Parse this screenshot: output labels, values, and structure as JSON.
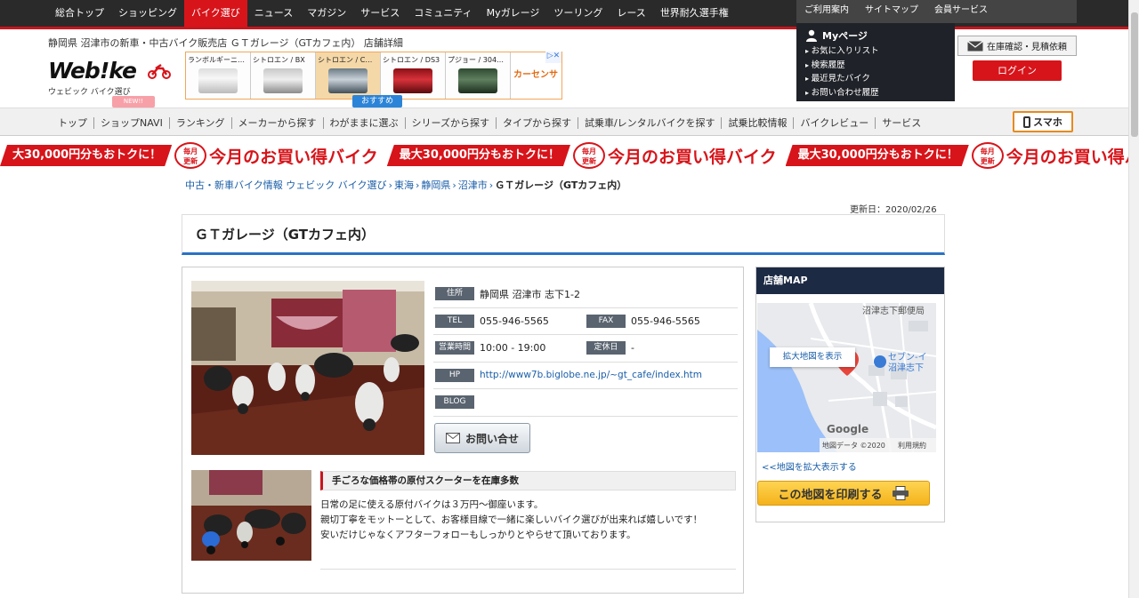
{
  "topnav": {
    "items": [
      "総合トップ",
      "ショッピング",
      "バイク選び",
      "ニュース",
      "マガジン",
      "サービス",
      "コミュニティ",
      "Myガレージ",
      "ツーリング",
      "レース",
      "世界耐久選手権"
    ],
    "active_index": 2,
    "sub_items": [
      "ご利用案内",
      "サイトマップ",
      "会員サービス"
    ]
  },
  "header": {
    "breadcrumb_title": "静岡県 沼津市の新車・中古バイク販売店 ＧＴガレージ（GTカフェ内） 店舗詳細",
    "logo_text": "Web!ke",
    "logo_tagline": "ウェビック バイク選び",
    "new_badge": "NEW!!",
    "recommend_label": "おすすめ",
    "ad_badge": "▷✕",
    "ads": [
      "ランボルギーニ…",
      "シトロエン / BX",
      "シトロエン / C…",
      "シトロエン / DS3",
      "プジョー / 304…"
    ],
    "ad_brand": "カーセンサー",
    "estimate_label": "在庫確認・見積依頼",
    "login_label": "ログイン"
  },
  "mypage": {
    "title": "Myページ",
    "items": [
      "お気に入りリスト",
      "検索履歴",
      "最近見たバイク",
      "お問い合わせ履歴"
    ]
  },
  "nav2": {
    "items": [
      "トップ",
      "ショップNAVI",
      "ランキング",
      "メーカーから探す",
      "わがままに選ぶ",
      "シリーズから探す",
      "タイプから探す",
      "試乗車/レンタルバイクを探す",
      "試乗比較情報",
      "バイクレビュー",
      "サービス"
    ],
    "smartphone_label": "スマホ"
  },
  "banner": {
    "discount": "最大30,000円分もおトクに！",
    "discount_cut": "大30,000円分もおトクに！",
    "badge_line1": "毎月",
    "badge_line2": "更新",
    "headline": "今月のお買い得バイク"
  },
  "breadcrumb": [
    "中古・新車バイク情報 ウェビック バイク選び",
    "東海",
    "静岡県",
    "沼津市",
    "ＧＴガレージ（GTカフェ内）"
  ],
  "updated": "更新日：2020/02/26",
  "shop": {
    "name": "ＧＴガレージ（GTカフェ内）",
    "address_label": "住所",
    "address": "静岡県 沼津市 志下1-2",
    "tel_label": "TEL",
    "tel": "055-946-5565",
    "fax_label": "FAX",
    "fax": "055-946-5565",
    "hours_label": "営業時間",
    "hours": "10:00 - 19:00",
    "closed_label": "定休日",
    "closed": "-",
    "hp_label": "HP",
    "hp": "http://www7b.biglobe.ne.jp/~gt_cafe/index.htm",
    "blog_label": "BLOG",
    "contact_label": "お問い合せ"
  },
  "feature": {
    "heading": "手ごろな価格帯の原付スクーターを在庫多数",
    "lines": [
      "日常の足に使える原付バイクは３万円～御座います。",
      "親切丁寧をモットーとして、お客様目線で一緒に楽しいバイク選びが出来れば嬉しいです！",
      "安いだけじゃなくアフターフォローもしっかりとやらせて頂いております。"
    ]
  },
  "map": {
    "title": "店舗MAP",
    "enlarge_label": "拡大地図を表示",
    "label_post": "沼津志下郵便局",
    "label_store1": "セブン-イ",
    "label_store2": "沼津志下",
    "google": "Google",
    "attribution": "地図データ ©2020",
    "terms": "利用規約",
    "expand_link": "<<地図を拡大表示する",
    "print_label": "この地図を印刷する"
  }
}
